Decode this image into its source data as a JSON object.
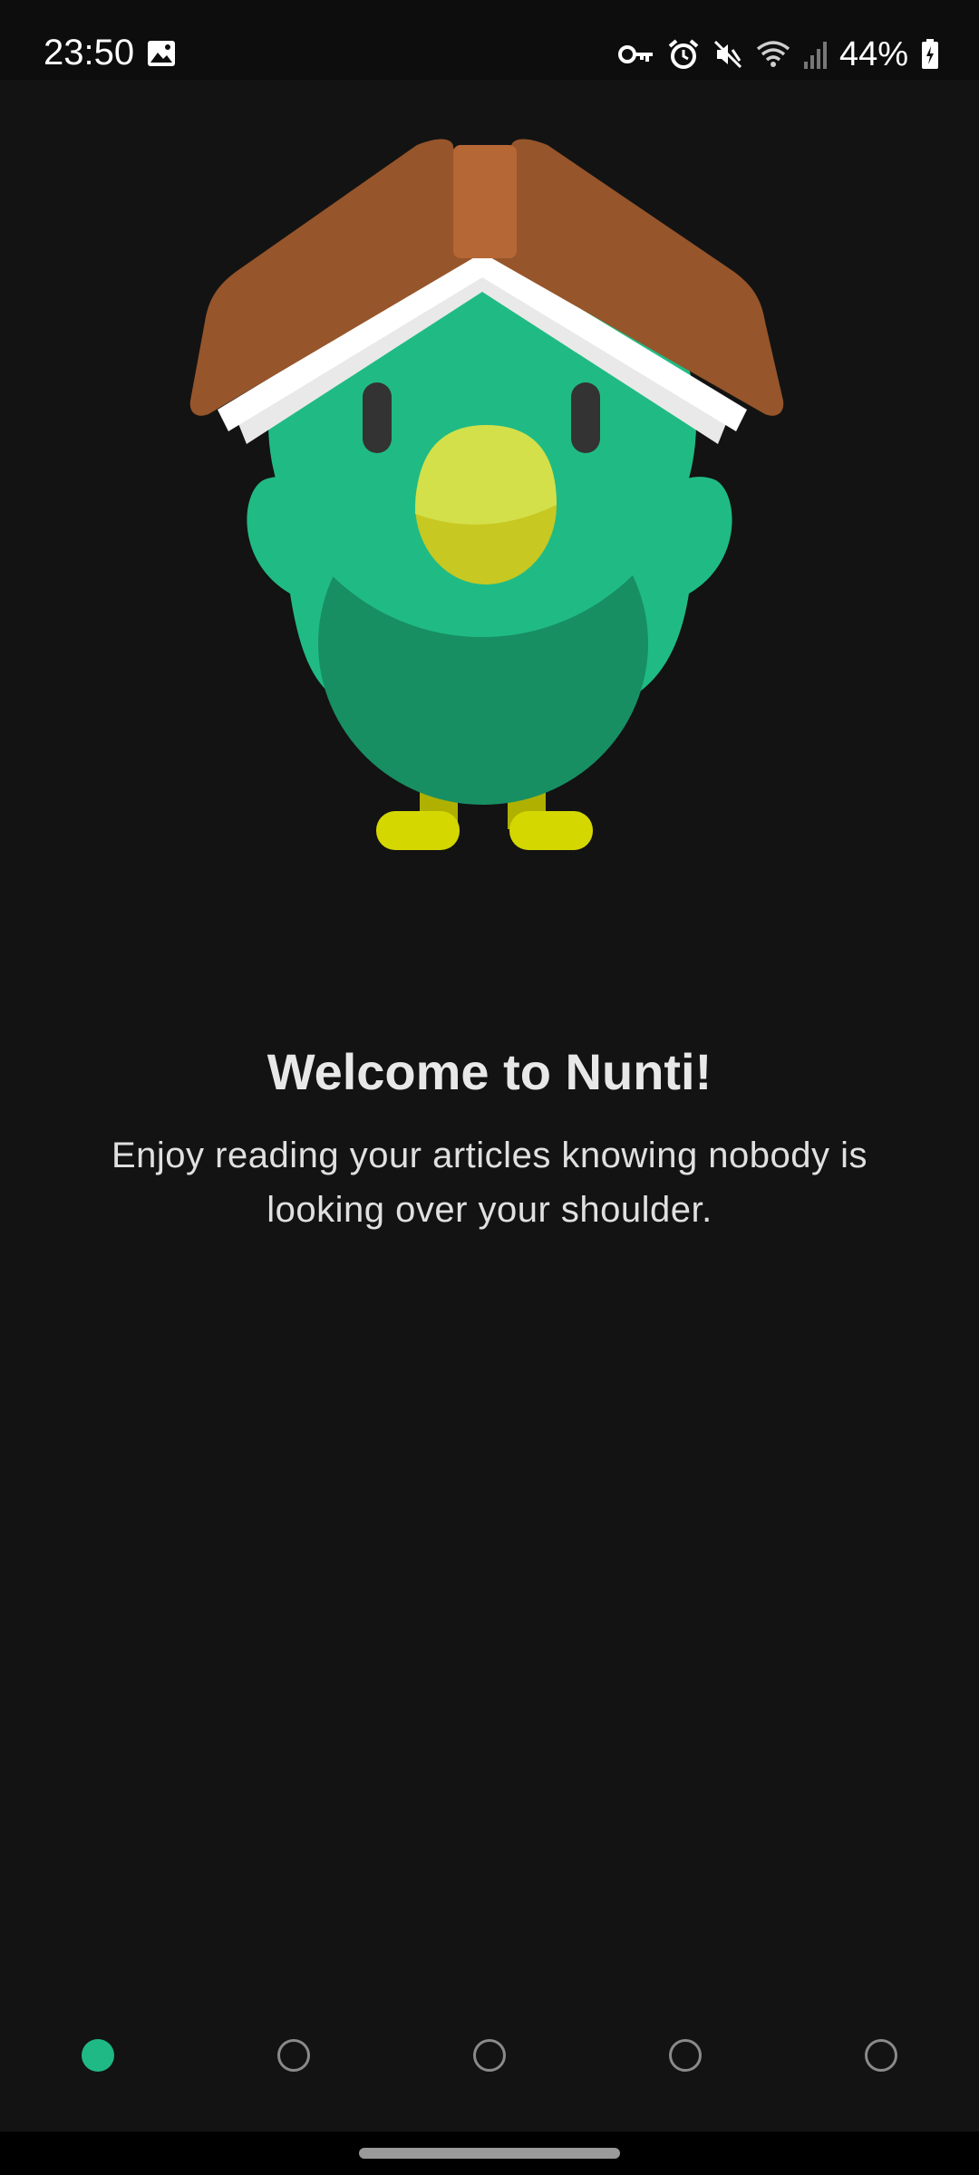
{
  "status_bar": {
    "time": "23:50",
    "battery": "44%",
    "icons": [
      "image-icon",
      "vpn-key-icon",
      "alarm-icon",
      "mute-icon",
      "wifi-icon",
      "signal-icon",
      "battery-charging-icon"
    ]
  },
  "onboarding": {
    "title": "Welcome to Nunti!",
    "subtitle": "Enjoy reading your articles knowing nobody is looking over your shoulder.",
    "page_count": 5,
    "current_page": 1
  },
  "colors": {
    "background": "#131313",
    "accent": "#1fb985",
    "bird_body": "#20bb84",
    "bird_belly": "#178f63",
    "book_cover": "#96552a",
    "beak": "#d3e04a",
    "feet": "#d4d800"
  }
}
